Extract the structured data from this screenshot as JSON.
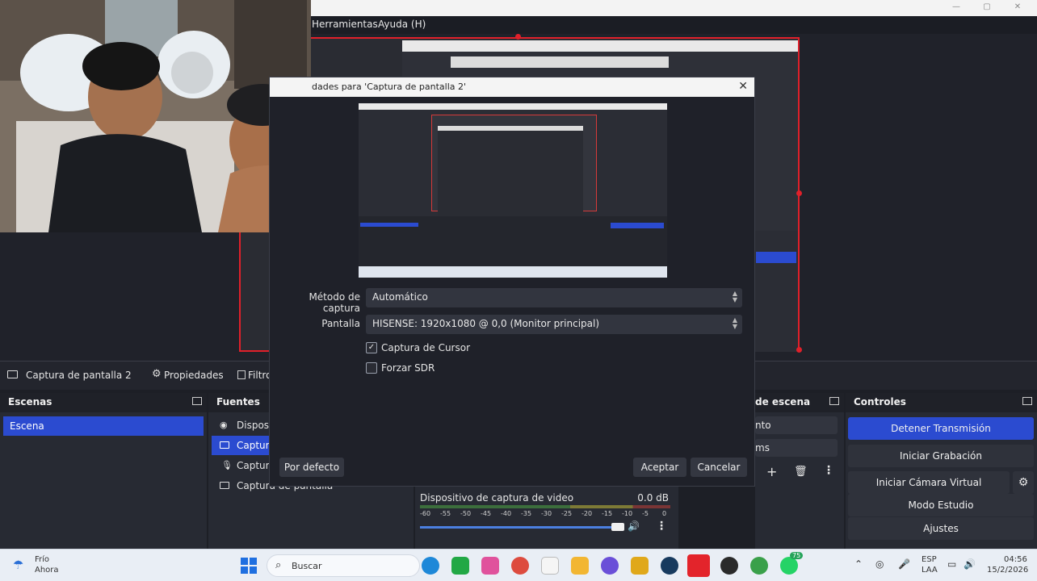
{
  "menu": {
    "herramientas": "Herramientas",
    "ayuda": "Ayuda (H)"
  },
  "dialog": {
    "title": "dades para 'Captura de pantalla 2'",
    "metodo_label": "Método de captura",
    "metodo_value": "Automático",
    "pantalla_label": "Pantalla",
    "pantalla_value": "HISENSE: 1920x1080 @ 0,0 (Monitor principal)",
    "cursor_label": "Captura de Cursor",
    "cursor_checked": "✓",
    "sdr_label": "Forzar SDR",
    "default_btn": "Por defecto",
    "accept_btn": "Aceptar",
    "cancel_btn": "Cancelar"
  },
  "source_bar": {
    "source_name": "Captura de pantalla 2",
    "properties": "Propiedades",
    "filters": "Filtro"
  },
  "scenes": {
    "title": "Escenas",
    "items": [
      "Escena"
    ]
  },
  "sources": {
    "title": "Fuentes",
    "items": [
      "Disposit",
      "Captura",
      "Captura",
      "Captura de pantalla"
    ]
  },
  "transitions": {
    "title": "de escena",
    "item1": "nto",
    "item2": "ms"
  },
  "controls": {
    "title": "Controles",
    "stop_stream": "Detener Transmisión",
    "start_recording": "Iniciar Grabación",
    "virtual_cam": "Iniciar Cámara Virtual",
    "studio_mode": "Modo Estudio",
    "settings": "Ajustes"
  },
  "mixer": {
    "device": "Dispositivo de captura de video",
    "level": "0.0 dB",
    "ticks": [
      "-60",
      "-55",
      "-50",
      "-45",
      "-40",
      "-35",
      "-30",
      "-25",
      "-20",
      "-15",
      "-10",
      "-5",
      "0"
    ]
  },
  "taskbar": {
    "weather": "Frío",
    "weather_sub": "Ahora",
    "search": "Buscar",
    "lang1": "ESP",
    "lang2": "LAA",
    "time": "04:56",
    "date": "15/2/2026",
    "badge": "75"
  },
  "colors": {
    "accent": "#2b4bd0",
    "selection_red": "#e0202a",
    "dialog_bg": "#1f2129"
  }
}
